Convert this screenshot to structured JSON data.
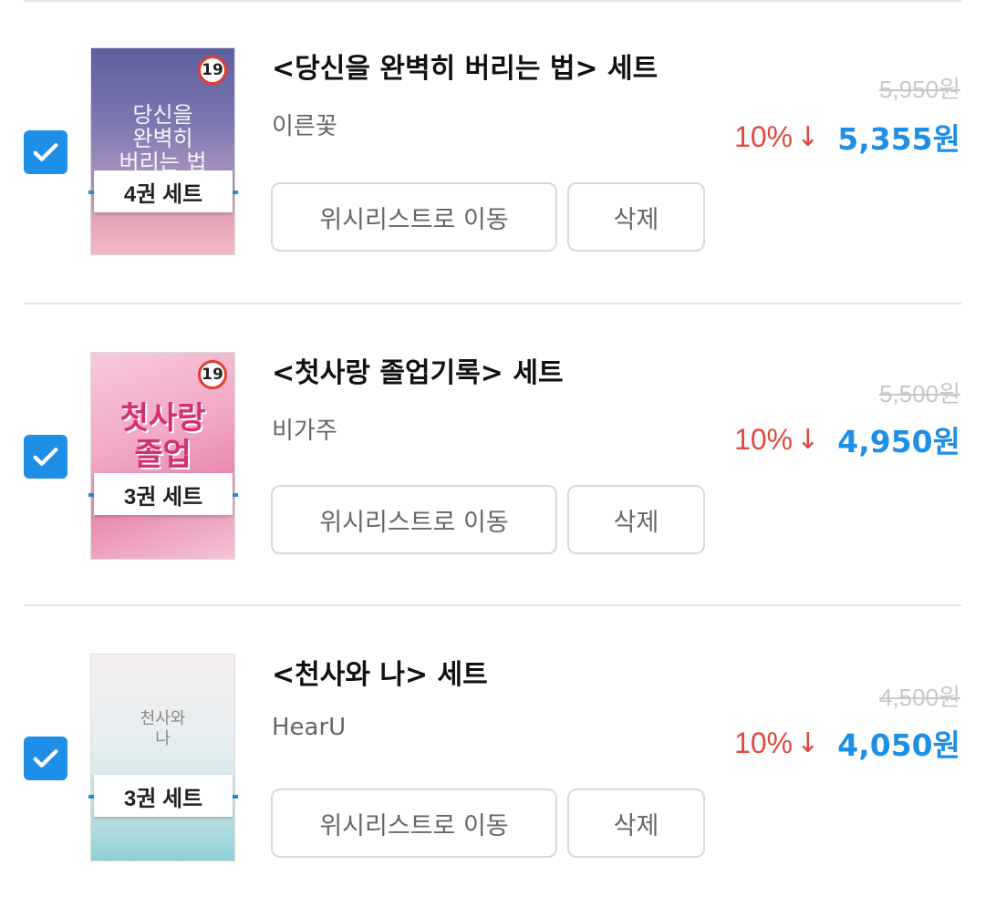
{
  "items": [
    {
      "title": "<당신을 완벽히 버리는 법> 세트",
      "author": "이른꽃",
      "checked": true,
      "age_rating": "19",
      "cover_text": "당신을\n완벽히\n버리는 법",
      "set_badge": "4권 세트",
      "wishlist_label": "위시리스트로 이동",
      "delete_label": "삭제",
      "original_price": "5,950원",
      "discount": "10%",
      "discount_arrow": "↓",
      "price": "5,355원"
    },
    {
      "title": "<첫사랑 졸업기록> 세트",
      "author": "비가주",
      "checked": true,
      "age_rating": "19",
      "cover_text": "첫사랑\n졸업",
      "set_badge": "3권 세트",
      "wishlist_label": "위시리스트로 이동",
      "delete_label": "삭제",
      "original_price": "5,500원",
      "discount": "10%",
      "discount_arrow": "↓",
      "price": "4,950원"
    },
    {
      "title": "<천사와 나> 세트",
      "author": "HearU",
      "checked": true,
      "cover_text": "천사와\n나",
      "set_badge": "3권 세트",
      "wishlist_label": "위시리스트로 이동",
      "delete_label": "삭제",
      "original_price": "4,500원",
      "discount": "10%",
      "discount_arrow": "↓",
      "price": "4,050원"
    }
  ],
  "colors": {
    "accent": "#1e8fe6",
    "discount": "#e0493d",
    "age_badge_ring": "#e23b2f"
  },
  "icons": {
    "checkbox": "checkmark-icon",
    "age": "age-19-icon"
  }
}
